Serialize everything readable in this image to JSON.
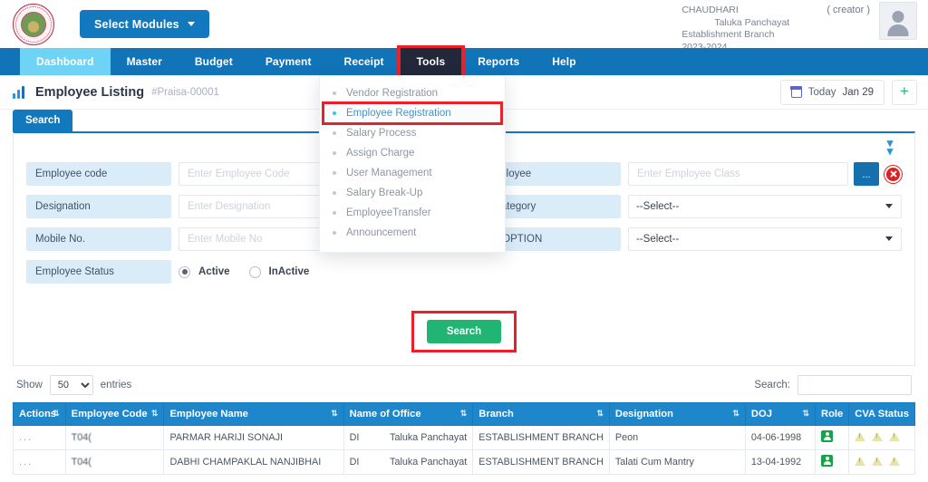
{
  "header": {
    "logo_alt": "government-emblem",
    "modules_button": "Select Modules",
    "user": {
      "line1": "CHAUDHARI",
      "line2": "Taluka Panchayat",
      "line3": "Establishment Branch",
      "line4": "2023-2024",
      "role": "( creator )"
    }
  },
  "nav": {
    "items": [
      {
        "label": "Dashboard",
        "state": "active"
      },
      {
        "label": "Master",
        "state": "normal"
      },
      {
        "label": "Budget",
        "state": "normal"
      },
      {
        "label": "Payment",
        "state": "normal"
      },
      {
        "label": "Receipt",
        "state": "normal"
      },
      {
        "label": "Tools",
        "state": "open"
      },
      {
        "label": "Reports",
        "state": "normal"
      },
      {
        "label": "Help",
        "state": "normal"
      }
    ]
  },
  "tools_menu": {
    "items": [
      {
        "label": "Vendor Registration",
        "selected": false
      },
      {
        "label": "Employee Registration",
        "selected": true
      },
      {
        "label": "Salary Process",
        "selected": false
      },
      {
        "label": "Assign Charge",
        "selected": false
      },
      {
        "label": "User Management",
        "selected": false
      },
      {
        "label": "Salary Break-Up",
        "selected": false
      },
      {
        "label": "EmployeeTransfer",
        "selected": false
      },
      {
        "label": "Announcement",
        "selected": false
      }
    ]
  },
  "page": {
    "title": "Employee Listing",
    "code": "#Praisa-00001",
    "today_label": "Today",
    "today_date": "Jan 29",
    "add_label": "+"
  },
  "search_panel": {
    "tab_label": "Search",
    "collapse_icon": "double-chevron-down",
    "fields": {
      "employee_code": {
        "label": "Employee code",
        "value": "",
        "placeholder": "Enter Employee Code"
      },
      "designation": {
        "label": "Designation",
        "value": "",
        "placeholder": "Enter Designation"
      },
      "mobile_no": {
        "label": "Mobile No.",
        "value": "",
        "placeholder": "Enter Mobile No"
      },
      "employee_status": {
        "label": "Employee Status",
        "option_active": "Active",
        "option_inactive": "InActive",
        "selected": "Active"
      },
      "employee_class": {
        "label": "Employee",
        "value": "",
        "placeholder": "Enter Employee Class",
        "picker_label": "...",
        "clear_label": "clear"
      },
      "employee_category": {
        "label": "e Category",
        "value": "--Select--"
      },
      "loan_option": {
        "label": "AN OPTION",
        "value": "--Select--"
      }
    },
    "submit_label": "Search"
  },
  "table": {
    "show_label": "Show",
    "entries_value": "50",
    "entries_label": "entries",
    "search_label": "Search:",
    "search_value": "",
    "columns": [
      {
        "label": "Actions",
        "sortable": true
      },
      {
        "label": "Employee Code",
        "sortable": true
      },
      {
        "label": "Employee Name",
        "sortable": true
      },
      {
        "label": "Name of Office",
        "sortable": false
      },
      {
        "label": "Branch",
        "sortable": true
      },
      {
        "label": "Designation",
        "sortable": true
      },
      {
        "label": "DOJ",
        "sortable": true
      },
      {
        "label": "Role",
        "sortable": false
      },
      {
        "label": "CVA Status",
        "sortable": false
      }
    ],
    "rows": [
      {
        "actions": "...",
        "employee_code": "T04(",
        "employee_name": "PARMAR HARIJI SONAJI",
        "office_prefix": "DI",
        "office_name": "Taluka Panchayat",
        "branch": "ESTABLISHMENT BRANCH",
        "designation": "Peon",
        "doj": "04-06-1998",
        "role": "active-user-badge",
        "cva_status": [
          "warning",
          "warning",
          "warning"
        ]
      },
      {
        "actions": "...",
        "employee_code": "T04(",
        "employee_name": "DABHI CHAMPAKLAL NANJIBHAI",
        "office_prefix": "DI",
        "office_name": "Taluka Panchayat",
        "branch": "ESTABLISHMENT BRANCH",
        "designation": "Talati Cum Mantry",
        "doj": "13-04-1992",
        "role": "active-user-badge",
        "cva_status": [
          "warning",
          "warning",
          "warning"
        ]
      }
    ]
  },
  "colors": {
    "nav_blue": "#1173b8",
    "nav_active": "#6fd3f5",
    "nav_open": "#22283a",
    "highlight_red": "#e8212a",
    "submit_green": "#20b573",
    "table_head": "#1e87cb",
    "label_bg": "#dbecf9"
  }
}
